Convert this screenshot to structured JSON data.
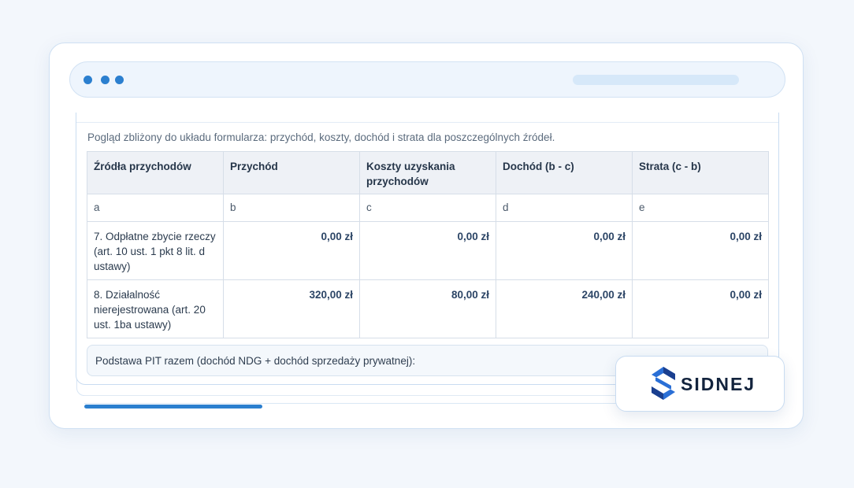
{
  "description": "Pogląd zbliżony do układu formularza: przychód, koszty, dochód i strata dla poszczególnych źródeł.",
  "table": {
    "headers": [
      "Źródła przychodów",
      "Przychód",
      "Koszty uzyskania przychodów",
      "Dochód (b - c)",
      "Strata (c - b)"
    ],
    "letters": [
      "a",
      "b",
      "c",
      "d",
      "e"
    ],
    "rows": [
      {
        "source": "7. Odpłatne zbycie rzeczy (art. 10 ust. 1 pkt 8 lit. d ustawy)",
        "przychod": "0,00 zł",
        "koszty": "0,00 zł",
        "dochod": "0,00 zł",
        "strata": "0,00 zł"
      },
      {
        "source": "8. Działalność nierejestrowana (art. 20 ust. 1ba ustawy)",
        "przychod": "320,00 zł",
        "koszty": "80,00 zł",
        "dochod": "240,00 zł",
        "strata": "0,00 zł"
      }
    ]
  },
  "summary": {
    "label": "Podstawa PIT razem (dochód NDG + dochód sprzedaży prywatnej):"
  },
  "progress": {
    "fraction": 0.26
  },
  "logo": {
    "text": "SIDNEJ",
    "icon": "sidnej-logo-icon"
  },
  "colors": {
    "accent": "#2b7fcf",
    "logo_dark": "#12233d",
    "logo_blue": "#2a6fd6"
  }
}
